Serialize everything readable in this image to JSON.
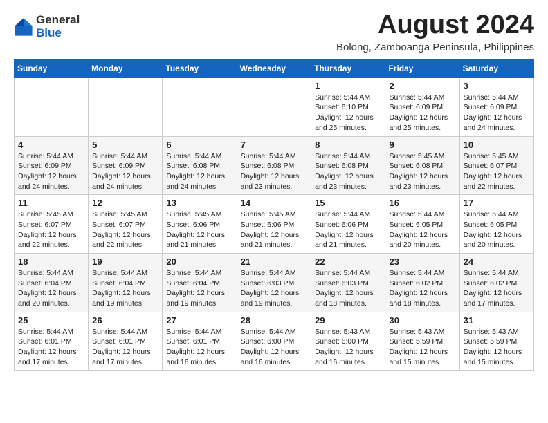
{
  "logo": {
    "general": "General",
    "blue": "Blue"
  },
  "title": {
    "month_year": "August 2024",
    "location": "Bolong, Zamboanga Peninsula, Philippines"
  },
  "days_of_week": [
    "Sunday",
    "Monday",
    "Tuesday",
    "Wednesday",
    "Thursday",
    "Friday",
    "Saturday"
  ],
  "weeks": [
    [
      {
        "day": "",
        "info": ""
      },
      {
        "day": "",
        "info": ""
      },
      {
        "day": "",
        "info": ""
      },
      {
        "day": "",
        "info": ""
      },
      {
        "day": "1",
        "info": "Sunrise: 5:44 AM\nSunset: 6:10 PM\nDaylight: 12 hours\nand 25 minutes."
      },
      {
        "day": "2",
        "info": "Sunrise: 5:44 AM\nSunset: 6:09 PM\nDaylight: 12 hours\nand 25 minutes."
      },
      {
        "day": "3",
        "info": "Sunrise: 5:44 AM\nSunset: 6:09 PM\nDaylight: 12 hours\nand 24 minutes."
      }
    ],
    [
      {
        "day": "4",
        "info": "Sunrise: 5:44 AM\nSunset: 6:09 PM\nDaylight: 12 hours\nand 24 minutes."
      },
      {
        "day": "5",
        "info": "Sunrise: 5:44 AM\nSunset: 6:09 PM\nDaylight: 12 hours\nand 24 minutes."
      },
      {
        "day": "6",
        "info": "Sunrise: 5:44 AM\nSunset: 6:08 PM\nDaylight: 12 hours\nand 24 minutes."
      },
      {
        "day": "7",
        "info": "Sunrise: 5:44 AM\nSunset: 6:08 PM\nDaylight: 12 hours\nand 23 minutes."
      },
      {
        "day": "8",
        "info": "Sunrise: 5:44 AM\nSunset: 6:08 PM\nDaylight: 12 hours\nand 23 minutes."
      },
      {
        "day": "9",
        "info": "Sunrise: 5:45 AM\nSunset: 6:08 PM\nDaylight: 12 hours\nand 23 minutes."
      },
      {
        "day": "10",
        "info": "Sunrise: 5:45 AM\nSunset: 6:07 PM\nDaylight: 12 hours\nand 22 minutes."
      }
    ],
    [
      {
        "day": "11",
        "info": "Sunrise: 5:45 AM\nSunset: 6:07 PM\nDaylight: 12 hours\nand 22 minutes."
      },
      {
        "day": "12",
        "info": "Sunrise: 5:45 AM\nSunset: 6:07 PM\nDaylight: 12 hours\nand 22 minutes."
      },
      {
        "day": "13",
        "info": "Sunrise: 5:45 AM\nSunset: 6:06 PM\nDaylight: 12 hours\nand 21 minutes."
      },
      {
        "day": "14",
        "info": "Sunrise: 5:45 AM\nSunset: 6:06 PM\nDaylight: 12 hours\nand 21 minutes."
      },
      {
        "day": "15",
        "info": "Sunrise: 5:44 AM\nSunset: 6:06 PM\nDaylight: 12 hours\nand 21 minutes."
      },
      {
        "day": "16",
        "info": "Sunrise: 5:44 AM\nSunset: 6:05 PM\nDaylight: 12 hours\nand 20 minutes."
      },
      {
        "day": "17",
        "info": "Sunrise: 5:44 AM\nSunset: 6:05 PM\nDaylight: 12 hours\nand 20 minutes."
      }
    ],
    [
      {
        "day": "18",
        "info": "Sunrise: 5:44 AM\nSunset: 6:04 PM\nDaylight: 12 hours\nand 20 minutes."
      },
      {
        "day": "19",
        "info": "Sunrise: 5:44 AM\nSunset: 6:04 PM\nDaylight: 12 hours\nand 19 minutes."
      },
      {
        "day": "20",
        "info": "Sunrise: 5:44 AM\nSunset: 6:04 PM\nDaylight: 12 hours\nand 19 minutes."
      },
      {
        "day": "21",
        "info": "Sunrise: 5:44 AM\nSunset: 6:03 PM\nDaylight: 12 hours\nand 19 minutes."
      },
      {
        "day": "22",
        "info": "Sunrise: 5:44 AM\nSunset: 6:03 PM\nDaylight: 12 hours\nand 18 minutes."
      },
      {
        "day": "23",
        "info": "Sunrise: 5:44 AM\nSunset: 6:02 PM\nDaylight: 12 hours\nand 18 minutes."
      },
      {
        "day": "24",
        "info": "Sunrise: 5:44 AM\nSunset: 6:02 PM\nDaylight: 12 hours\nand 17 minutes."
      }
    ],
    [
      {
        "day": "25",
        "info": "Sunrise: 5:44 AM\nSunset: 6:01 PM\nDaylight: 12 hours\nand 17 minutes."
      },
      {
        "day": "26",
        "info": "Sunrise: 5:44 AM\nSunset: 6:01 PM\nDaylight: 12 hours\nand 17 minutes."
      },
      {
        "day": "27",
        "info": "Sunrise: 5:44 AM\nSunset: 6:01 PM\nDaylight: 12 hours\nand 16 minutes."
      },
      {
        "day": "28",
        "info": "Sunrise: 5:44 AM\nSunset: 6:00 PM\nDaylight: 12 hours\nand 16 minutes."
      },
      {
        "day": "29",
        "info": "Sunrise: 5:43 AM\nSunset: 6:00 PM\nDaylight: 12 hours\nand 16 minutes."
      },
      {
        "day": "30",
        "info": "Sunrise: 5:43 AM\nSunset: 5:59 PM\nDaylight: 12 hours\nand 15 minutes."
      },
      {
        "day": "31",
        "info": "Sunrise: 5:43 AM\nSunset: 5:59 PM\nDaylight: 12 hours\nand 15 minutes."
      }
    ]
  ]
}
